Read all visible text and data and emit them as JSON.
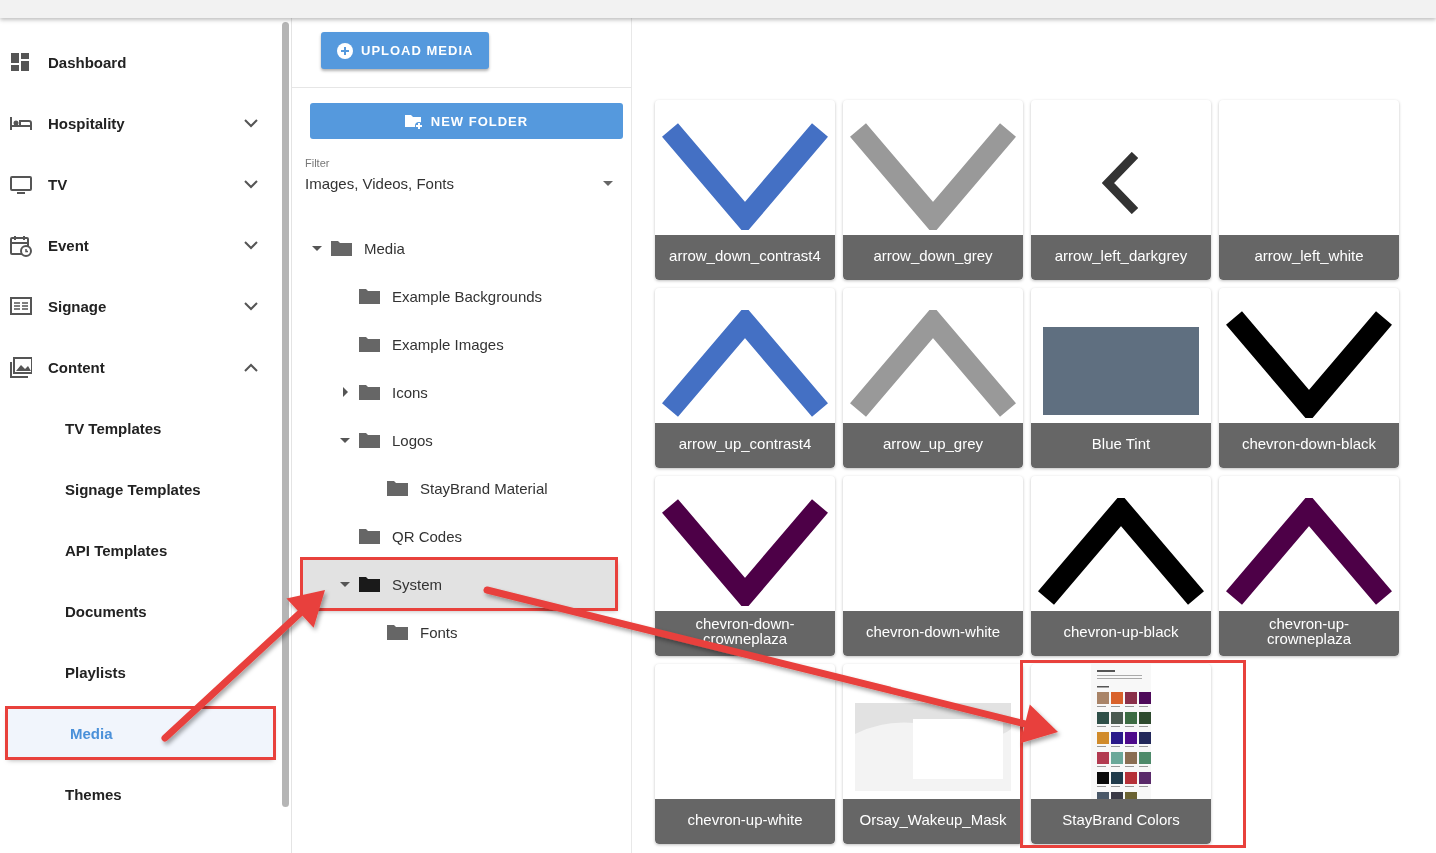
{
  "sidebar": {
    "items": [
      {
        "label": "Dashboard"
      },
      {
        "label": "Hospitality",
        "expanded": false
      },
      {
        "label": "TV",
        "expanded": false
      },
      {
        "label": "Event",
        "expanded": false
      },
      {
        "label": "Signage",
        "expanded": false
      },
      {
        "label": "Content",
        "expanded": true,
        "children": [
          {
            "label": "TV Templates",
            "selected": false,
            "highlighted": false
          },
          {
            "label": "Signage Templates",
            "selected": false,
            "highlighted": false
          },
          {
            "label": "API Templates",
            "selected": false,
            "highlighted": false
          },
          {
            "label": "Documents",
            "selected": false,
            "highlighted": false
          },
          {
            "label": "Playlists",
            "selected": false,
            "highlighted": false
          },
          {
            "label": "Media",
            "selected": true,
            "highlighted": true
          },
          {
            "label": "Themes",
            "selected": false,
            "highlighted": false
          }
        ]
      }
    ]
  },
  "upload_button": "UPLOAD MEDIA",
  "new_folder_button": "NEW FOLDER",
  "filter": {
    "label": "Filter",
    "value": "Images, Videos, Fonts"
  },
  "tree": [
    {
      "label": "Media",
      "expanded": true,
      "selected": false,
      "highlighted": false,
      "children": [
        {
          "label": "Example Backgrounds",
          "selected": false,
          "highlighted": false
        },
        {
          "label": "Example Images",
          "selected": false,
          "highlighted": false
        },
        {
          "label": "Icons",
          "expanded": false,
          "selected": false,
          "highlighted": false
        },
        {
          "label": "Logos",
          "expanded": true,
          "selected": false,
          "highlighted": false,
          "children": [
            {
              "label": "StayBrand Material",
              "selected": false,
              "highlighted": false
            }
          ]
        },
        {
          "label": "QR Codes",
          "selected": false,
          "highlighted": false
        },
        {
          "label": "System",
          "expanded": true,
          "selected": true,
          "highlighted": true,
          "children": [
            {
              "label": "Fonts",
              "selected": false,
              "highlighted": false
            }
          ]
        }
      ]
    }
  ],
  "media": [
    {
      "label": "arrow_down_contrast4",
      "thumbnail": {
        "kind": "chevron_down",
        "color": "#4470c4"
      },
      "highlighted": false
    },
    {
      "label": "arrow_down_grey",
      "thumbnail": {
        "kind": "chevron_down",
        "color": "#999999"
      },
      "highlighted": false
    },
    {
      "label": "arrow_left_darkgrey",
      "thumbnail": {
        "kind": "chevron_left",
        "color": "#333333"
      },
      "highlighted": false
    },
    {
      "label": "arrow_left_white",
      "thumbnail": {
        "kind": "blank"
      },
      "highlighted": false
    },
    {
      "label": "arrow_up_contrast4",
      "thumbnail": {
        "kind": "chevron_up",
        "color": "#4470c4"
      },
      "highlighted": false
    },
    {
      "label": "arrow_up_grey",
      "thumbnail": {
        "kind": "chevron_up",
        "color": "#999999"
      },
      "highlighted": false
    },
    {
      "label": "Blue Tint",
      "thumbnail": {
        "kind": "swatch",
        "color": "#5f6f80"
      },
      "highlighted": false
    },
    {
      "label": "chevron-down-black",
      "thumbnail": {
        "kind": "chevron_down",
        "color": "#000000"
      },
      "highlighted": false
    },
    {
      "label": "chevron-down-crowneplaza",
      "thumbnail": {
        "kind": "chevron_down",
        "color": "#4d0047"
      },
      "highlighted": false
    },
    {
      "label": "chevron-down-white",
      "thumbnail": {
        "kind": "blank"
      },
      "highlighted": false
    },
    {
      "label": "chevron-up-black",
      "thumbnail": {
        "kind": "chevron_up",
        "color": "#000000"
      },
      "highlighted": false
    },
    {
      "label": "chevron-up-crowneplaza",
      "thumbnail": {
        "kind": "chevron_up",
        "color": "#4d0047"
      },
      "highlighted": false
    },
    {
      "label": "chevron-up-white",
      "thumbnail": {
        "kind": "blank"
      },
      "highlighted": false
    },
    {
      "label": "Orsay_Wakeup_Mask",
      "thumbnail": {
        "kind": "photo"
      },
      "highlighted": false
    },
    {
      "label": "StayBrand Colors",
      "thumbnail": {
        "kind": "document"
      },
      "highlighted": true
    }
  ],
  "annotation_arrows": true
}
